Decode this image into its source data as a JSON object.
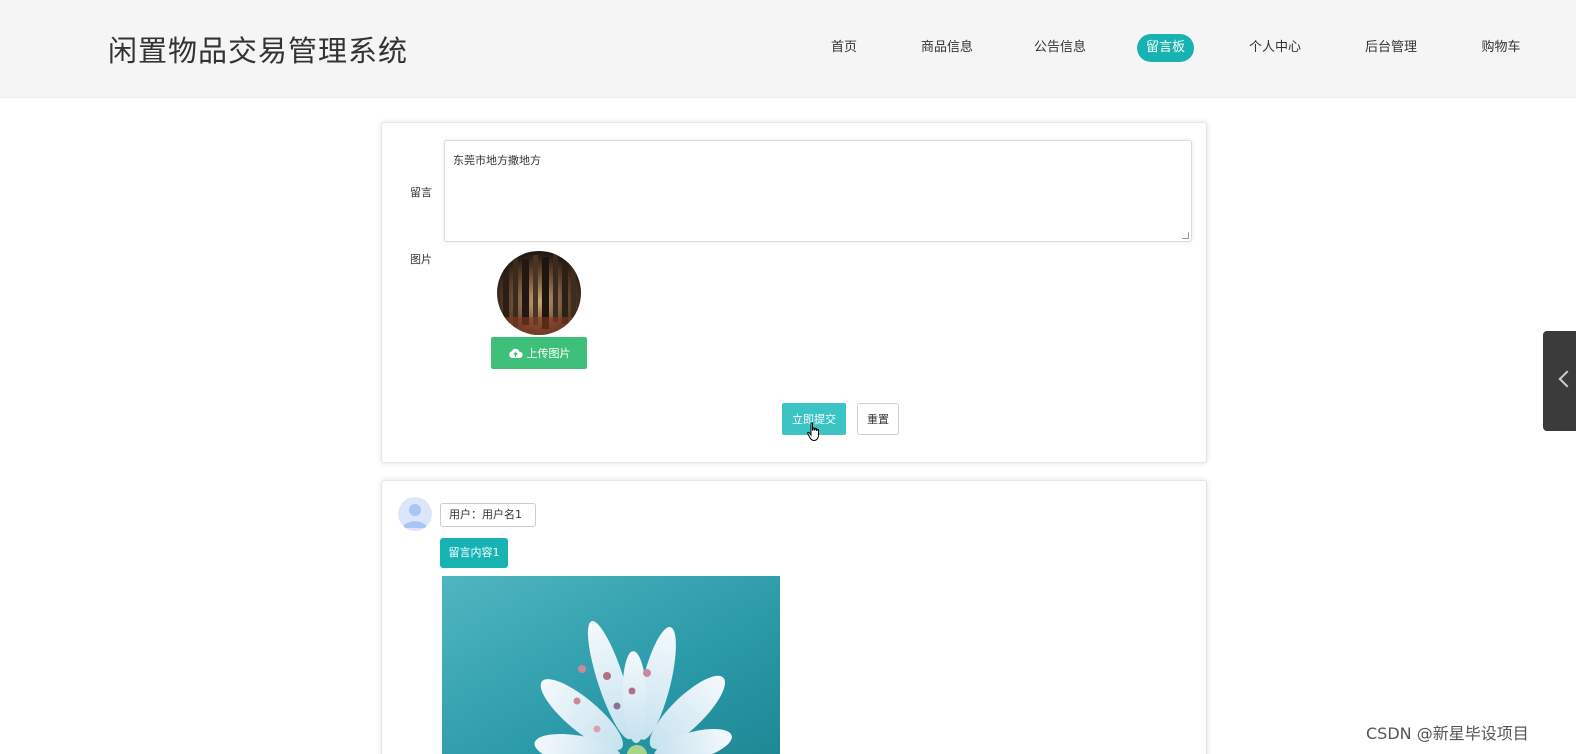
{
  "header": {
    "site_title": "闲置物品交易管理系统",
    "nav": [
      {
        "label": "首页"
      },
      {
        "label": "商品信息"
      },
      {
        "label": "公告信息"
      },
      {
        "label": "留言板"
      },
      {
        "label": "个人中心"
      },
      {
        "label": "后台管理"
      },
      {
        "label": "购物车"
      }
    ],
    "active_nav": "留言板"
  },
  "form": {
    "message_label": "留言",
    "message_value": "东莞市地方撒地方",
    "image_label": "图片",
    "upload_label": "上传图片",
    "submit_label": "立即提交",
    "reset_label": "重置"
  },
  "messages": [
    {
      "user": "用户：用户名1",
      "content": "留言内容1"
    }
  ],
  "colors": {
    "accent": "#17b3b3",
    "upload": "#3ec07a",
    "submit": "#3cc3c3",
    "header_bg": "#f5f5f5"
  },
  "watermark": "CSDN @新星毕设项目"
}
